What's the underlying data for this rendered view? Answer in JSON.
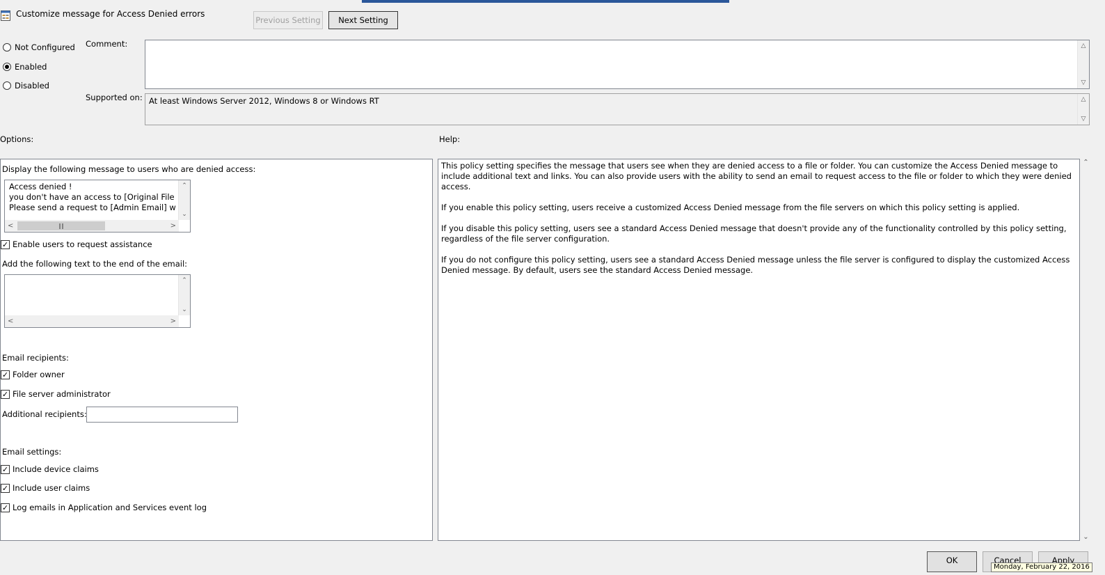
{
  "window": {
    "title": "Customize message for Access Denied errors",
    "icon": "policy-setting-icon"
  },
  "nav": {
    "previous_label": "Previous Setting",
    "next_label": "Next Setting"
  },
  "state": {
    "options": [
      "Not Configured",
      "Enabled",
      "Disabled"
    ],
    "selected": "Enabled"
  },
  "comment": {
    "label": "Comment:",
    "value": ""
  },
  "supported": {
    "label": "Supported on:",
    "value": "At least Windows Server 2012, Windows 8 or Windows RT"
  },
  "options_panel": {
    "label": "Options:",
    "message_label": "Display the following message to users who are denied access:",
    "message_lines": [
      "Access denied !",
      "you don't have an access to [Original File Path",
      "Please send a request to [Admin Email] with th"
    ],
    "enable_assistance": {
      "label": "Enable users to request assistance",
      "checked": true
    },
    "email_append_label": "Add the following text to the end of the email:",
    "email_append_value": "",
    "recipients_label": "Email recipients:",
    "folder_owner": {
      "label": "Folder owner",
      "checked": true
    },
    "file_server_admin": {
      "label": "File server administrator",
      "checked": true
    },
    "additional_label": "Additional recipients:",
    "additional_value": "",
    "settings_label": "Email settings:",
    "include_device_claims": {
      "label": "Include device claims",
      "checked": true
    },
    "include_user_claims": {
      "label": "Include user claims",
      "checked": true
    },
    "log_emails": {
      "label": "Log emails in Application and Services event log",
      "checked": true
    }
  },
  "help_panel": {
    "label": "Help:",
    "paragraphs": [
      "This policy setting specifies the message that users see when they are denied access to a file or folder. You can customize the Access Denied message to include additional text and links. You can also provide users with the ability to send an email to request access to the file or folder to which they were denied access.",
      "If you enable this policy setting, users receive a customized Access Denied message from the file servers on which this policy setting is applied.",
      "If you disable this policy setting, users see a standard Access Denied message that doesn't provide any of the functionality controlled by this policy setting, regardless of the file server configuration.",
      "If you do not configure this policy setting, users see a standard Access Denied message unless the file server is configured to display the customized Access Denied message. By default, users see the standard Access Denied message."
    ]
  },
  "footer": {
    "ok_label": "OK",
    "cancel_label": "Cancel",
    "apply_label": "Apply",
    "date_tooltip": "Monday, February 22, 2016"
  },
  "colors": {
    "window_bg": "#f0f0f0",
    "accent": "#2b579a"
  }
}
